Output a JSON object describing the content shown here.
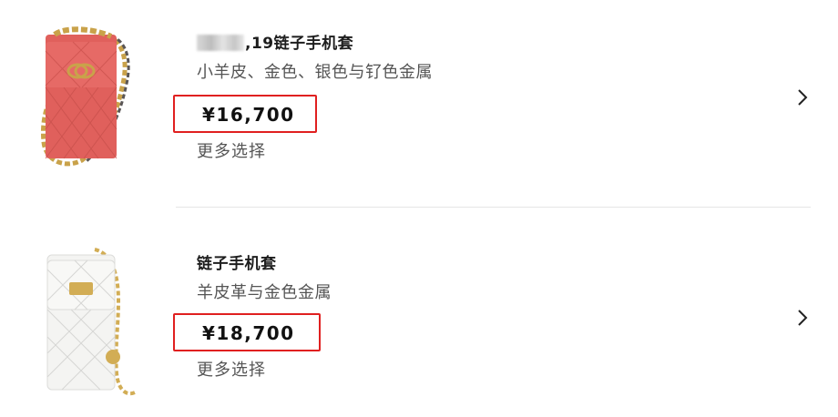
{
  "products": [
    {
      "title_suffix": ",19链子手机套",
      "material": "小羊皮、金色、银色与钌色金属",
      "price": "¥16,700",
      "more": "更多选择",
      "image_icon": "pink-quilted-phone-holder-bag-icon",
      "colors": {
        "bag": "#e0605c",
        "chain_gold": "#c9a24a",
        "chain_dark": "#5a5656"
      }
    },
    {
      "title": "链子手机套",
      "material": "羊皮革与金色金属",
      "price": "¥18,700",
      "more": "更多选择",
      "image_icon": "white-quilted-phone-holder-bag-icon",
      "colors": {
        "bag": "#f4f4f2",
        "chain_gold": "#d2ad55"
      }
    }
  ],
  "highlight_color": "#e02020",
  "chevron_icon": "chevron-right-icon"
}
